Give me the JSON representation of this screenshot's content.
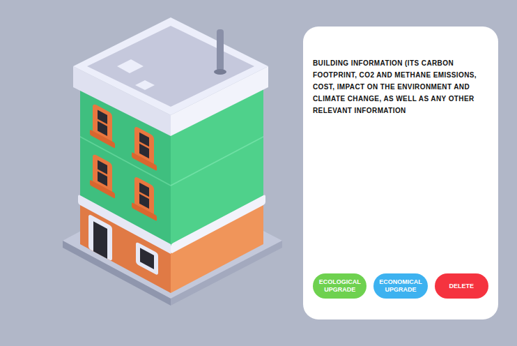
{
  "info_panel": {
    "description": "BUILDING INFORMATION (ITS CARBON FOOTPRINT, CO2 AND METHANE EMISSIONS, COST, IMPACT ON THE ENVIRONMENT AND CLIMATE CHANGE, AS WELL AS ANY OTHER RELEVANT INFORMATION",
    "buttons": [
      {
        "label": "ECOLOGICAL UPGRADE",
        "color": "#6ed14f"
      },
      {
        "label": "ECONOMICAL UPGRADE",
        "color": "#3db2f0"
      },
      {
        "label": "DELETE",
        "color": "#f5333f"
      }
    ]
  }
}
